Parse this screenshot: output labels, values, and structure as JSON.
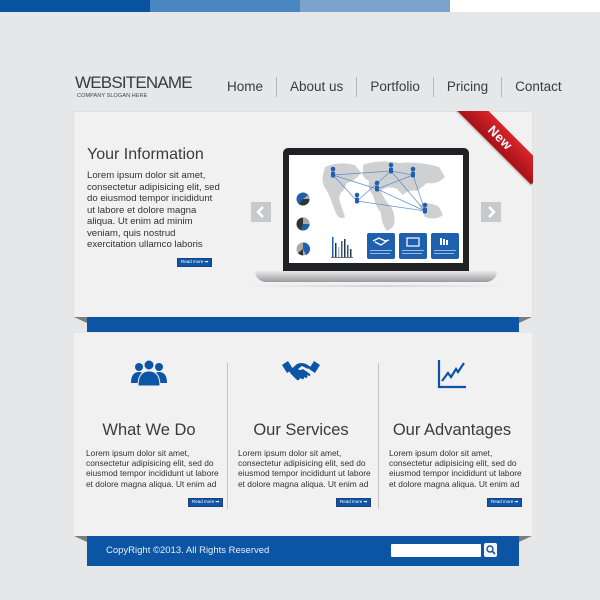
{
  "colors": {
    "brand_blue": "#0c55a5",
    "topbar": [
      "#0a53a3",
      "#4a86c0",
      "#7ba4cd",
      "#ffffff"
    ],
    "ribbon_red": "#c81d23",
    "background": "#e6e7e9",
    "panel": "#f1f1f2"
  },
  "header": {
    "site_name": "WEBSITENAME",
    "slogan": "COMPANY SLOGAN HERE",
    "nav": [
      {
        "label": "Home"
      },
      {
        "label": "About us"
      },
      {
        "label": "Portfolio"
      },
      {
        "label": "Pricing"
      },
      {
        "label": "Contact"
      }
    ]
  },
  "hero": {
    "title": "Your Information",
    "text": "Lorem ipsum dolor sit amet, consectetur adipisicing elit, sed do eiusmod tempor incididunt ut labore et dolore magna aliqua. Ut enim ad minim veniam, quis nostrud exercitation ullamco laboris",
    "read_more": "Read more ➡",
    "ribbon": "New",
    "prev_icon": "chevron-left-icon",
    "next_icon": "chevron-right-icon",
    "image": "laptop-infographic-world-map"
  },
  "features": [
    {
      "icon": "users-group-icon",
      "title": "What We Do",
      "text": "Lorem ipsum dolor sit amet, consectetur adipisicing elit, sed do eiusmod tempor incididunt ut labore et dolore magna aliqua. Ut enim ad",
      "read_more": "Read more ➡"
    },
    {
      "icon": "handshake-icon",
      "title": "Our Services",
      "text": "Lorem ipsum dolor sit amet, consectetur adipisicing elit, sed do eiusmod tempor incididunt ut labore et dolore magna aliqua. Ut enim ad",
      "read_more": "Read more ➡"
    },
    {
      "icon": "growth-chart-icon",
      "title": "Our Advantages",
      "text": "Lorem ipsum dolor sit amet, consectetur adipisicing elit, sed do eiusmod tempor incididunt ut labore et dolore magna aliqua. Ut enim ad",
      "read_more": "Read more ➡"
    }
  ],
  "footer": {
    "copyright": "CopyRight ©2013. All Rights Reserved",
    "search_value": "",
    "search_icon": "search-icon"
  }
}
